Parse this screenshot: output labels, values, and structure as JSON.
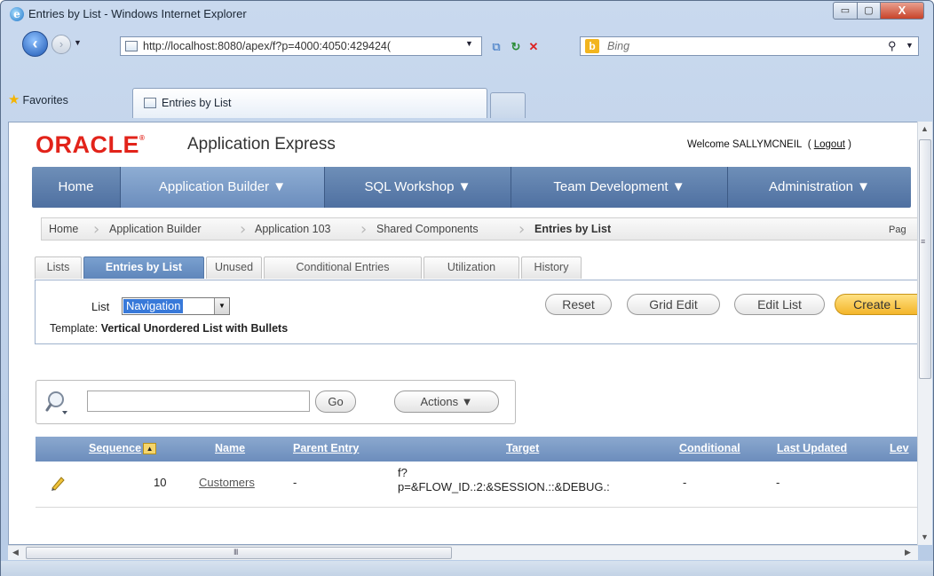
{
  "window": {
    "title": "Entries by List - Windows Internet Explorer",
    "min_glyph": "▭",
    "max_glyph": "▢",
    "close_glyph": "X"
  },
  "browser": {
    "address_url": "http://localhost:8080/apex/f?p=4000:4050:429424(",
    "search_placeholder": "Bing",
    "favorites_label": "Favorites",
    "tab_title": "Entries by List"
  },
  "header": {
    "logo_text": "ORACLE",
    "product": "Application Express",
    "welcome_prefix": "Welcome SALLYMCNEIL",
    "logout_label": "Logout"
  },
  "main_nav": [
    {
      "label": "Home"
    },
    {
      "label": "Application Builder ▼"
    },
    {
      "label": "SQL Workshop ▼"
    },
    {
      "label": "Team Development ▼"
    },
    {
      "label": "Administration ▼"
    }
  ],
  "breadcrumb": [
    {
      "label": "Home"
    },
    {
      "label": "Application Builder"
    },
    {
      "label": "Application 103"
    },
    {
      "label": "Shared Components"
    },
    {
      "label": "Entries by List"
    }
  ],
  "breadcrumb_right": "Pag",
  "sub_tabs": [
    {
      "label": "Lists"
    },
    {
      "label": "Entries by List"
    },
    {
      "label": "Unused"
    },
    {
      "label": "Conditional Entries"
    },
    {
      "label": "Utilization"
    },
    {
      "label": "History"
    }
  ],
  "panel": {
    "list_label": "List",
    "list_value": "Navigation",
    "template_label": "Template:",
    "template_value": "Vertical Unordered List with Bullets",
    "buttons": {
      "reset": "Reset",
      "grid_edit": "Grid Edit",
      "edit_list": "Edit List",
      "create": "Create L"
    }
  },
  "search": {
    "input_value": "",
    "go_label": "Go",
    "actions_label": "Actions ▼"
  },
  "grid": {
    "columns": [
      "Sequence",
      "Name",
      "Parent Entry",
      "Target",
      "Conditional",
      "Last Updated",
      "Lev"
    ],
    "rows": [
      {
        "sequence": "10",
        "name": "Customers",
        "parent": "-",
        "target_line1": "f?",
        "target_line2": "p=&FLOW_ID.:2:&SESSION.::&DEBUG.:",
        "conditional": "-",
        "last_updated": "-"
      }
    ]
  },
  "scrollbar_grip": "III",
  "colors": {
    "oracle_red": "#e2231a",
    "nav_blue": "#5a7bab",
    "create_button": "#f3b52a"
  }
}
